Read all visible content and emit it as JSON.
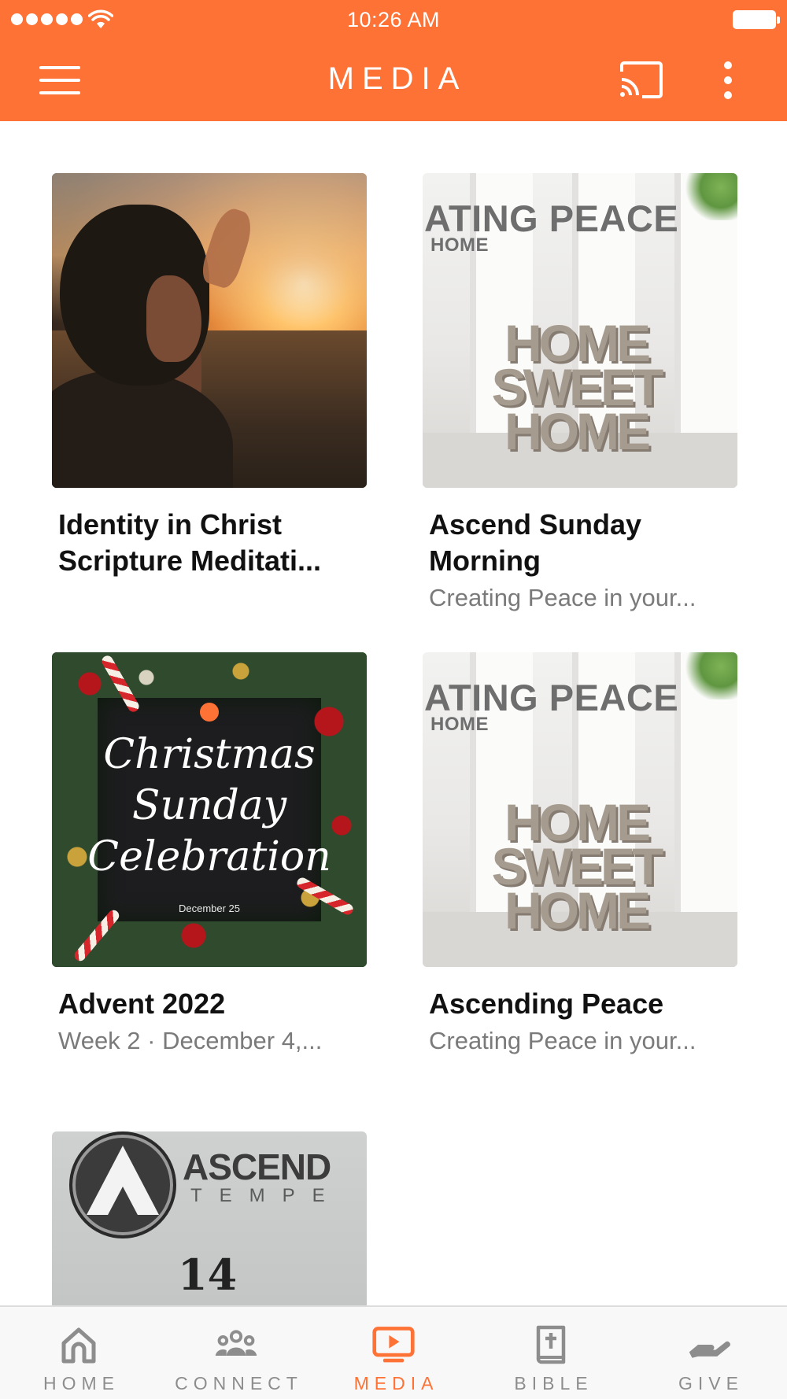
{
  "status_bar": {
    "time": "10:26 AM"
  },
  "header": {
    "title": "MEDIA"
  },
  "items": [
    {
      "title": "Identity in Christ Scripture Meditati...",
      "subtitle": ""
    },
    {
      "title": "Ascend Sunday Morning",
      "subtitle": "Creating Peace in your...",
      "thumb": {
        "heading": "ATING PEACE",
        "subheading": "HOME",
        "sign_lines": [
          "HOME",
          "SWEET",
          "HOME"
        ]
      }
    },
    {
      "title": "Advent 2022",
      "subtitle": "Week 2 · December 4,...",
      "thumb": {
        "script_lines": [
          "Christmas",
          "Sunday",
          "Celebration"
        ],
        "date": "December 25"
      }
    },
    {
      "title": "Ascending Peace",
      "subtitle": "Creating Peace in your...",
      "thumb": {
        "heading": "ATING PEACE",
        "subheading": "HOME",
        "sign_lines": [
          "HOME",
          "SWEET",
          "HOME"
        ]
      }
    },
    {
      "title": "",
      "subtitle": "",
      "thumb": {
        "brand": "ASCEND",
        "brand_sub": "TEMPE",
        "number": "14"
      }
    }
  ],
  "tabs": [
    {
      "label": "HOME",
      "icon": "home-icon",
      "active": false
    },
    {
      "label": "CONNECT",
      "icon": "people-icon",
      "active": false
    },
    {
      "label": "MEDIA",
      "icon": "tv-play-icon",
      "active": true
    },
    {
      "label": "BIBLE",
      "icon": "bible-icon",
      "active": false
    },
    {
      "label": "GIVE",
      "icon": "give-hand-icon",
      "active": false
    }
  ],
  "colors": {
    "accent": "#FF7236",
    "inactive_tab": "#8D8D8D",
    "subtitle": "#7A7A7A"
  }
}
